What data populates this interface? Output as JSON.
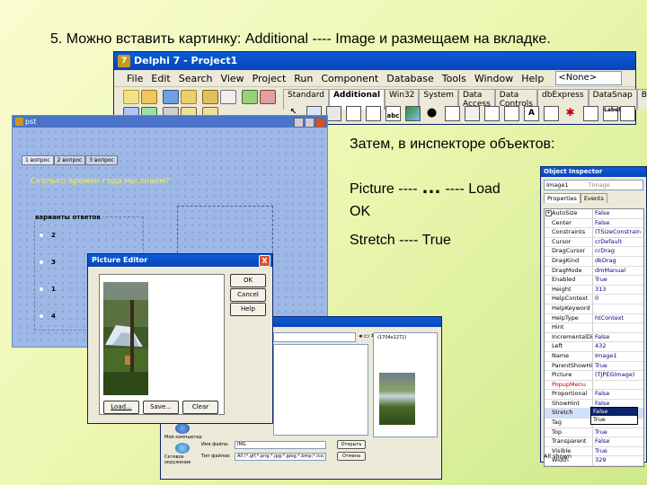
{
  "slide": {
    "heading": "5. Можно вставить картинку: Additional ---- Image   и размещаем на вкладке.",
    "then_text": "Затем, в инспекторе объектов:",
    "step1_left": "Picture ---- ",
    "step1_dots": "…",
    "step1_right": " ---- Load",
    "step2": "OK",
    "step3": "Stretch ---- True"
  },
  "ide": {
    "title": "Delphi 7 - Project1",
    "menu": [
      "File",
      "Edit",
      "Search",
      "View",
      "Project",
      "Run",
      "Component",
      "Database",
      "Tools",
      "Window",
      "Help"
    ],
    "combo_value": "<None>",
    "palette_tabs": [
      "Standard",
      "Additional",
      "Win32",
      "System",
      "Data Access",
      "Data Controls",
      "dbExpress",
      "DataSnap",
      "BDE"
    ],
    "active_tab": "Additional",
    "palette_icon_abc": "abc",
    "palette_icon_a": "A",
    "palette_icon_label": "Label"
  },
  "form_window": {
    "title": "рst",
    "tabs": [
      "1 вопрос",
      "2 вопрос",
      "3 вопрос"
    ],
    "question": "Сколько времен года мы знаем?",
    "group_label": "варианты ответов",
    "options": [
      "2",
      "3",
      "1",
      "4"
    ]
  },
  "object_inspector": {
    "title": "Object Inspector",
    "selected_object": "Image1",
    "selected_type": "TImage",
    "tabs": [
      "Properties",
      "Events"
    ],
    "rows": [
      {
        "name": "AutoSize",
        "value": "False"
      },
      {
        "name": "Center",
        "value": "False"
      },
      {
        "name": "Constraints",
        "value": "(TSizeConstrain"
      },
      {
        "name": "Cursor",
        "value": "crDefault"
      },
      {
        "name": "DragCursor",
        "value": "crDrag"
      },
      {
        "name": "DragKind",
        "value": "dkDrag"
      },
      {
        "name": "DragMode",
        "value": "dmManual"
      },
      {
        "name": "Enabled",
        "value": "True"
      },
      {
        "name": "Height",
        "value": "313"
      },
      {
        "name": "HelpContext",
        "value": "0"
      },
      {
        "name": "HelpKeyword",
        "value": ""
      },
      {
        "name": "HelpType",
        "value": "htContext"
      },
      {
        "name": "Hint",
        "value": ""
      },
      {
        "name": "IncrementalDisp",
        "value": "False"
      },
      {
        "name": "Left",
        "value": "432"
      },
      {
        "name": "Name",
        "value": "Image1"
      },
      {
        "name": "ParentShowHint",
        "value": "True"
      },
      {
        "name": "Picture",
        "value": "(TJPEGImage)"
      },
      {
        "name": "PopupMenu",
        "value": ""
      },
      {
        "name": "Proportional",
        "value": "False"
      },
      {
        "name": "ShowHint",
        "value": "False"
      },
      {
        "name": "Stretch",
        "value": "False"
      },
      {
        "name": "Tag",
        "value": "False"
      },
      {
        "name": "Top",
        "value": "True"
      },
      {
        "name": "Transparent",
        "value": "False"
      },
      {
        "name": "Visible",
        "value": "True"
      },
      {
        "name": "Width",
        "value": "329"
      }
    ],
    "dropdown_options": [
      "False",
      "True"
    ],
    "status": "All shown"
  },
  "picture_editor": {
    "title": "Picture Editor",
    "close_glyph": "X",
    "buttons": {
      "ok": "OK",
      "cancel": "Cancel",
      "help": "Help",
      "load": "Load...",
      "save": "Save...",
      "clear": "Clear"
    }
  },
  "open_dialog": {
    "preview_label": "(1704x2272)",
    "filename_label": "Имя файла:",
    "filename_value": "IMG",
    "filetype_label": "Тип файлов:",
    "filetype_value": "All (*.gif;*.png;*.jpg;*.jpeg;*.bmp;*.ico;*.emf;*.wmf)",
    "open_button": "Открыть",
    "cancel_button": "Отмена",
    "nav_items": [
      "Мой компьютер",
      "Сетевое окружение"
    ]
  }
}
